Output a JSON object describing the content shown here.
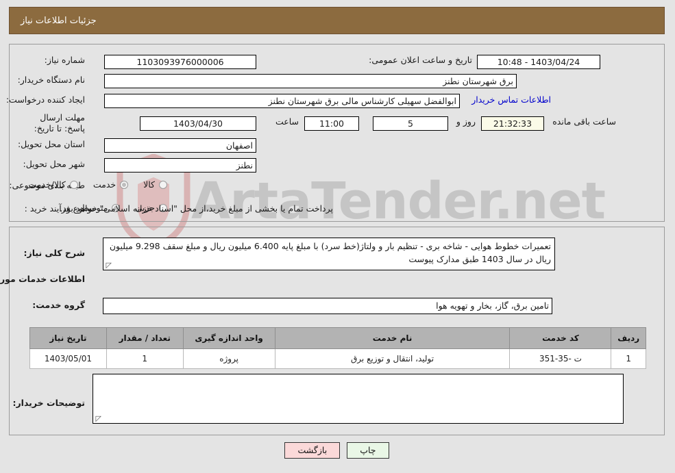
{
  "banner": {
    "title": "جزئیات اطلاعات نیاز"
  },
  "fields": {
    "need_number_label": "شماره نیاز:",
    "need_number_value": "1103093976000006",
    "public_announce_label": "تاریخ و ساعت اعلان عمومی:",
    "public_announce_value": "1403/04/24 - 10:48",
    "buyer_org_label": "نام دستگاه خریدار:",
    "buyer_org_value": "برق شهرستان نطنز",
    "creator_label": "ایجاد کننده درخواست:",
    "creator_value": "ابوالفضل سهیلی کارشناس مالی برق شهرستان نطنز",
    "contact_link": "اطلاعات تماس خریدار",
    "deadline_label": "مهلت ارسال پاسخ: تا تاریخ:",
    "deadline_date": "1403/04/30",
    "hour_label": "ساعت",
    "deadline_hour": "11:00",
    "days_value": "5",
    "days_label": "روز و",
    "countdown_value": "21:32:33",
    "countdown_label": "ساعت باقی مانده",
    "province_label": "استان محل تحویل:",
    "province_value": "اصفهان",
    "city_label": "شهر محل تحویل:",
    "city_value": "نطنز",
    "category_label": "طبقه بندی موضوعی:",
    "process_label": "نوع فرآیند خرید :",
    "process_note": "پرداخت تمام یا بخشی از مبلغ خرید،از محل \"اسناد خزانه اسلامی\" خواهد بود."
  },
  "category_options": [
    {
      "label": "کالا",
      "selected": false
    },
    {
      "label": "خدمت",
      "selected": true
    },
    {
      "label": "کالا/خدمت",
      "selected": false
    }
  ],
  "process_options": [
    {
      "label": "جزیی",
      "selected": false
    },
    {
      "label": "متوسط",
      "selected": true
    }
  ],
  "description": {
    "label": "شرح کلی نیاز:",
    "value": "تعمیرات خطوط هوایی - شاخه بری - تنظیم بار و ولتاژ(خط سرد) با مبلغ پایه 6.400 میلیون ریال و مبلغ سقف 9.298 میلیون ریال در سال 1403 طبق مدارک پیوست"
  },
  "services_section": {
    "heading": "اطلاعات خدمات مورد نیاز",
    "group_label": "گروه خدمت:",
    "group_value": "تامین برق، گاز، بخار و تهویه هوا"
  },
  "table": {
    "headers": [
      "ردیف",
      "کد خدمت",
      "نام خدمت",
      "واحد اندازه گیری",
      "تعداد / مقدار",
      "تاریخ نیاز"
    ],
    "rows": [
      {
        "row_no": "1",
        "service_code": "ت -35-351",
        "service_name": "تولید، انتقال و توزیع برق",
        "unit": "پروژه",
        "quantity": "1",
        "need_date": "1403/05/01"
      }
    ]
  },
  "buyer_notes": {
    "label": "توضیحات خریدار:",
    "value": ""
  },
  "buttons": {
    "back": "بازگشت",
    "print": "چاپ"
  },
  "watermark": {
    "text": "ArtaTender.net"
  },
  "colors": {
    "banner_bg": "#8c6b3f",
    "link": "#0000cc",
    "highlight": "#fbfbe8",
    "table_header": "#b3b3b3",
    "btn_back": "#fbd9d9",
    "btn_print": "#e9f7e6",
    "page_bg": "#e4e4e4"
  }
}
